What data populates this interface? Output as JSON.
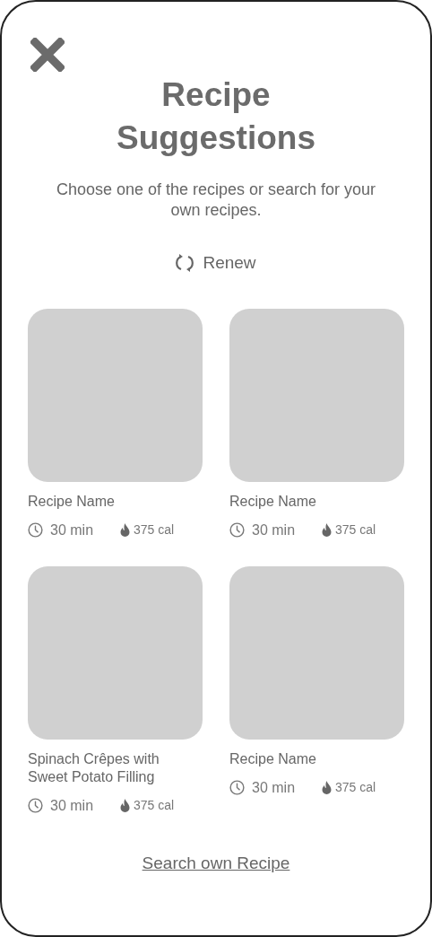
{
  "title": "Recipe Suggestions",
  "subtitle": "Choose one of the recipes or search for your own recipes.",
  "renew": {
    "label": "Renew"
  },
  "recipes": [
    {
      "name": "Recipe Name",
      "time": "30 min",
      "calories": "375 cal"
    },
    {
      "name": "Recipe Name",
      "time": "30 min",
      "calories": "375 cal"
    },
    {
      "name": "Spinach Crêpes with Sweet Potato Filling",
      "time": "30 min",
      "calories": "375 cal"
    },
    {
      "name": "Recipe Name",
      "time": "30 min",
      "calories": "375 cal"
    }
  ],
  "search_link": "Search own Recipe"
}
